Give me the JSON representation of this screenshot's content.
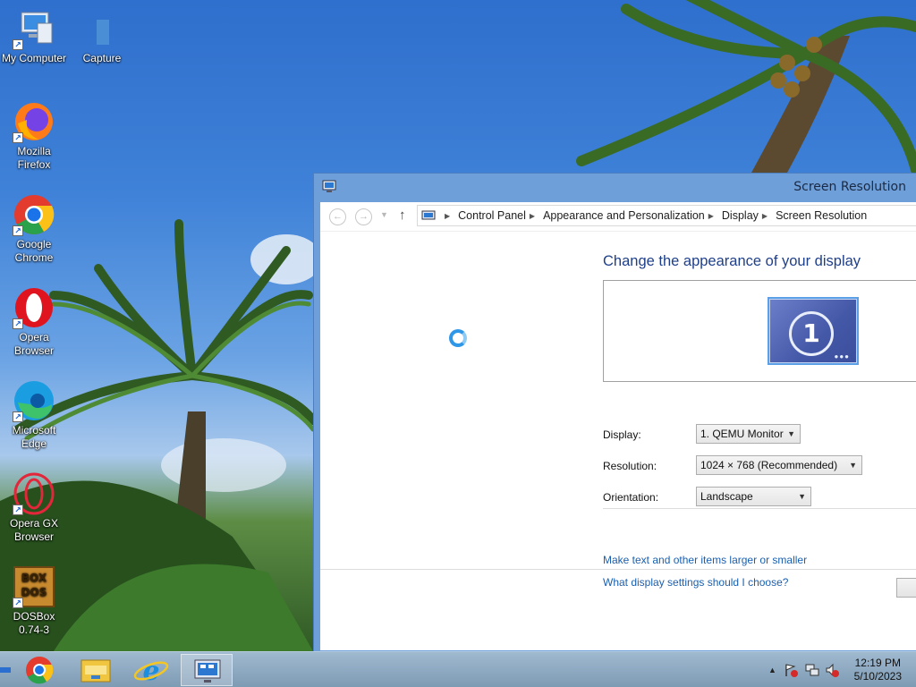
{
  "desktop": {
    "icons": [
      {
        "label": "My Computer",
        "icon": "computer-icon"
      },
      {
        "label": "Capture",
        "icon": "file-icon"
      },
      {
        "label": "Mozilla Firefox",
        "icon": "firefox-icon"
      },
      {
        "label": "Google Chrome",
        "icon": "chrome-icon"
      },
      {
        "label": "Opera Browser",
        "icon": "opera-icon"
      },
      {
        "label": "Microsoft Edge",
        "icon": "edge-icon"
      },
      {
        "label": "Opera GX Browser",
        "icon": "opera-gx-icon"
      },
      {
        "label": "DOSBox 0.74-3",
        "icon": "dosbox-icon"
      }
    ]
  },
  "window": {
    "title": "Screen Resolution",
    "breadcrumb": [
      "Control Panel",
      "Appearance and Personalization",
      "Display",
      "Screen Resolution"
    ],
    "heading": "Change the appearance of your display",
    "monitor_number": "1",
    "fields": {
      "display_label": "Display:",
      "display_value": "1. QEMU Monitor",
      "resolution_label": "Resolution:",
      "resolution_value": "1024 × 768 (Recommended)",
      "orientation_label": "Orientation:",
      "orientation_value": "Landscape"
    },
    "links": {
      "text_size": "Make text and other items larger or smaller",
      "help": "What display settings should I choose?"
    }
  },
  "taskbar": {
    "pinned": [
      "chrome-icon",
      "file-explorer-icon",
      "internet-explorer-icon",
      "control-panel-icon"
    ],
    "clock_time": "12:19 PM",
    "clock_date": "5/10/2023"
  },
  "colors": {
    "heading": "#1e3f8a",
    "link": "#1a5fb0",
    "window_frame": "#6f9fd8"
  }
}
